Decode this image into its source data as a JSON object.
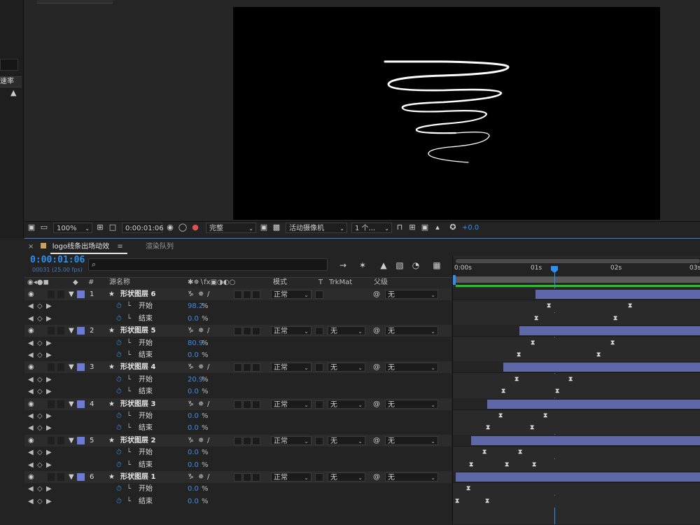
{
  "left_panel": {
    "tab_label": "速率"
  },
  "viewer_toolbar": {
    "zoom": "100%",
    "timecode": "0:00:01:06",
    "resolution": "完整",
    "camera": "活动摄像机",
    "views": "1 个...",
    "exposure": "+0.0"
  },
  "timeline": {
    "comp_tab": "logo线条出场动效",
    "render_tab": "渲染队列",
    "current_time": "0:00:01:06",
    "frame_info": "00031 (25.00 fps)",
    "search_icon": "⌕",
    "columns": {
      "num": "#",
      "source_name": "源名称",
      "mode": "模式",
      "t": "T",
      "trkmat": "TrkMat",
      "parent": "父级"
    },
    "ruler": [
      "0:00s",
      "01s",
      "02s",
      "03s"
    ],
    "layers": [
      {
        "num": "1",
        "name": "形状图层 6",
        "mode": "正常",
        "trkmat": "",
        "parent": "无",
        "props": [
          {
            "name": "开始",
            "value": "98.2",
            "unit": "%"
          },
          {
            "name": "结束",
            "value": "0.0",
            "unit": "%"
          }
        ]
      },
      {
        "num": "2",
        "name": "形状图层 5",
        "mode": "正常",
        "trkmat": "无",
        "parent": "无",
        "props": [
          {
            "name": "开始",
            "value": "80.9",
            "unit": "%"
          },
          {
            "name": "结束",
            "value": "0.0",
            "unit": "%"
          }
        ]
      },
      {
        "num": "3",
        "name": "形状图层 4",
        "mode": "正常",
        "trkmat": "无",
        "parent": "无",
        "props": [
          {
            "name": "开始",
            "value": "20.9",
            "unit": "%"
          },
          {
            "name": "结束",
            "value": "0.0",
            "unit": "%"
          }
        ]
      },
      {
        "num": "4",
        "name": "形状图层 3",
        "mode": "正常",
        "trkmat": "无",
        "parent": "无",
        "props": [
          {
            "name": "开始",
            "value": "0.0",
            "unit": "%"
          },
          {
            "name": "结束",
            "value": "0.0",
            "unit": "%"
          }
        ]
      },
      {
        "num": "5",
        "name": "形状图层 2",
        "mode": "正常",
        "trkmat": "无",
        "parent": "无",
        "props": [
          {
            "name": "开始",
            "value": "0.0",
            "unit": "%"
          },
          {
            "name": "结束",
            "value": "0.0",
            "unit": "%"
          }
        ]
      },
      {
        "num": "6",
        "name": "形状图层 1",
        "mode": "正常",
        "trkmat": "无",
        "parent": "无",
        "props": [
          {
            "name": "开始",
            "value": "0.0",
            "unit": "%"
          },
          {
            "name": "结束",
            "value": "0.0",
            "unit": "%"
          }
        ]
      }
    ]
  },
  "colors": {
    "accent": "#2f8ff0",
    "layer_label": "#6e7bd6",
    "layer_bar": "#5e67a8",
    "work_area": "#27c427"
  }
}
